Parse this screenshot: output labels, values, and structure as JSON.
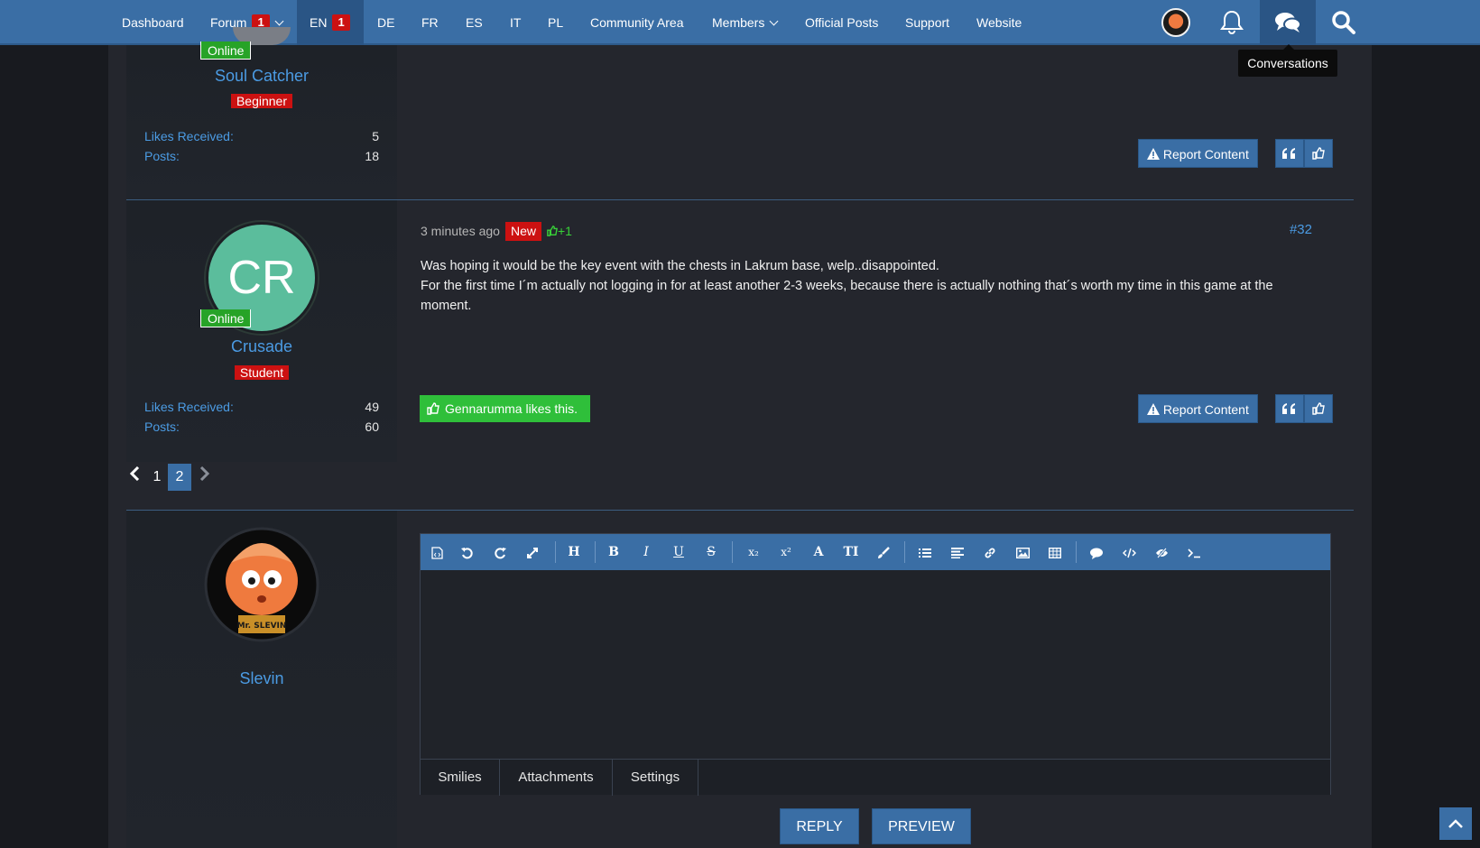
{
  "nav": {
    "dashboard": "Dashboard",
    "forum": "Forum",
    "forum_badge": "1",
    "lang_en": "EN",
    "lang_en_badge": "1",
    "lang_de": "DE",
    "lang_fr": "FR",
    "lang_es": "ES",
    "lang_it": "IT",
    "lang_pl": "PL",
    "community": "Community Area",
    "members": "Members",
    "official": "Official Posts",
    "support": "Support",
    "website": "Website",
    "icons": [
      "user-avatar",
      "bell-icon",
      "conversations-icon",
      "search-icon"
    ]
  },
  "tooltip": "Conversations",
  "post_prev": {
    "user": {
      "online": "Online",
      "name": "Soul Catcher",
      "rank": "Beginner",
      "likes_label": "Likes Received:",
      "likes_value": "5",
      "posts_label": "Posts:",
      "posts_value": "18"
    },
    "report": "Report Content"
  },
  "post": {
    "user": {
      "initials": "CR",
      "online": "Online",
      "name": "Crusade",
      "rank": "Student",
      "likes_label": "Likes Received:",
      "likes_value": "49",
      "posts_label": "Posts:",
      "posts_value": "60"
    },
    "time": "3 minutes ago",
    "new_label": "New",
    "like_count": "+1",
    "number": "#32",
    "lines": [
      "Was hoping it would be the key event with the chests in Lakrum base, welp..disappointed.",
      "For the first time I´m actually not logging in for at least another 2-3 weeks, because there is actually nothing that´s worth my time in this game at the moment."
    ],
    "likes_text": "Gennarumma likes this.",
    "report": "Report Content"
  },
  "pagination": {
    "pages": [
      "1",
      "2"
    ],
    "current": "2"
  },
  "reply": {
    "user": {
      "name": "Slevin",
      "avatar_caption": "Mr. SLEVIN"
    },
    "tabs": [
      "Smilies",
      "Attachments",
      "Settings"
    ],
    "reply_btn": "REPLY",
    "preview_btn": "PREVIEW"
  },
  "colors": {
    "nav_bg": "#3a6ea5",
    "accent_blue": "#4b9be3",
    "badge_red": "#cc1111",
    "online_green": "#27a327",
    "like_green": "#2fbf3a"
  }
}
